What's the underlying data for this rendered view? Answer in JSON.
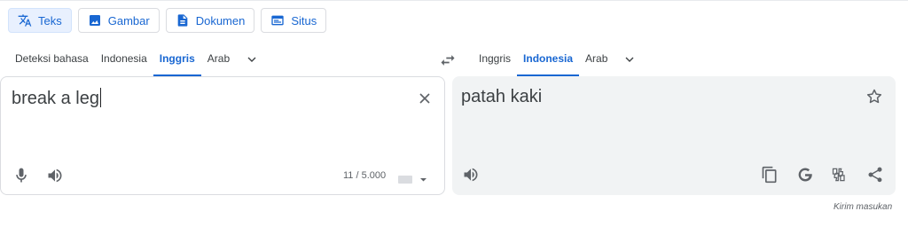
{
  "modes": [
    {
      "label": "Teks",
      "icon": "translate-icon",
      "active": true
    },
    {
      "label": "Gambar",
      "icon": "image-icon",
      "active": false
    },
    {
      "label": "Dokumen",
      "icon": "document-icon",
      "active": false
    },
    {
      "label": "Situs",
      "icon": "website-icon",
      "active": false
    }
  ],
  "source": {
    "languages": [
      "Deteksi bahasa",
      "Indonesia",
      "Inggris",
      "Arab"
    ],
    "selected": "Inggris",
    "text": "break a leg",
    "counter": "11 / 5.000"
  },
  "target": {
    "languages": [
      "Inggris",
      "Indonesia",
      "Arab"
    ],
    "selected": "Indonesia",
    "text": "patah kaki"
  },
  "feedback_label": "Kirim masukan",
  "colors": {
    "accent": "#1967d2",
    "active_bg": "#e8f0fe",
    "panel_bg": "#f1f3f4"
  }
}
